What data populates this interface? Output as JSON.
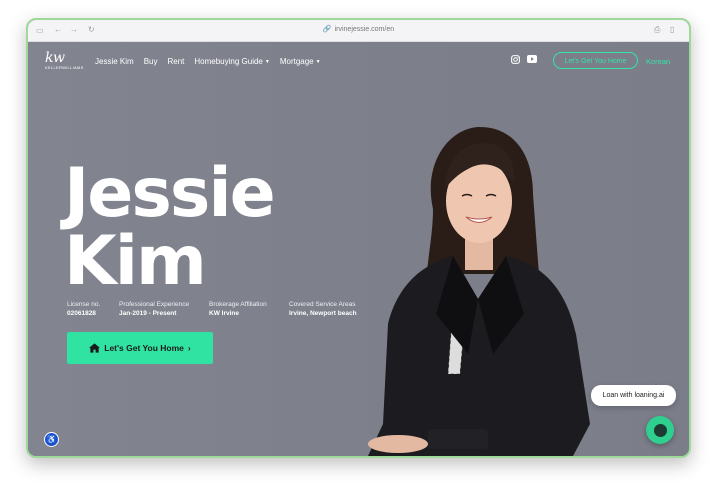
{
  "browser": {
    "url": "irvinejessie.com/en"
  },
  "nav": {
    "logo_main": "kw",
    "logo_sub": "KELLERWILLIAMS",
    "items": [
      "Jessie Kim",
      "Buy",
      "Rent",
      "Homebuying Guide",
      "Mortgage"
    ],
    "cta": "Let's Get You Home",
    "language": "Korean"
  },
  "hero": {
    "first_name": "Jessie",
    "last_name": "Kim",
    "meta": [
      {
        "label": "License no.",
        "value": "02061828"
      },
      {
        "label": "Professional Experience",
        "value": "Jan-2019 - Present"
      },
      {
        "label": "Brokerage Affiliation",
        "value": "KW Irvine"
      },
      {
        "label": "Covered Service Areas",
        "value": "Irvine, Newport beach"
      }
    ],
    "cta": "Let's Get You Home"
  },
  "chat": {
    "bubble": "Loan with loaning.ai"
  },
  "colors": {
    "accent": "#31e3a3",
    "background": "#7d7f8a"
  }
}
